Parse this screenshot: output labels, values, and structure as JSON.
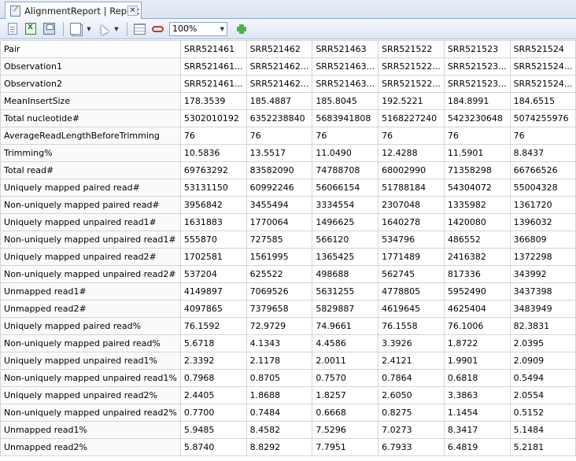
{
  "tab": {
    "title": "AlignmentReport | Report",
    "close_glyph": "✕",
    "icon": "report-icon"
  },
  "toolbar": {
    "buttons": [
      "new-document-icon",
      "export-excel-icon",
      "save-icon",
      "copy-pages-icon",
      "pointer-icon",
      "table-view-icon",
      "link-icon",
      "add-icon"
    ],
    "zoom": "100%"
  },
  "table": {
    "headers": [
      "Pair",
      "SRR521461",
      "SRR521462",
      "SRR521463",
      "SRR521522",
      "SRR521523",
      "SRR521524"
    ],
    "rows": [
      [
        "Observation1",
        "SRR521461...",
        "SRR521462...",
        "SRR521463...",
        "SRR521522...",
        "SRR521523...",
        "SRR521524..."
      ],
      [
        "Observation2",
        "SRR521461...",
        "SRR521462...",
        "SRR521463...",
        "SRR521522...",
        "SRR521523...",
        "SRR521524..."
      ],
      [
        "MeanInsertSize",
        "178.3539",
        "185.4887",
        "185.8045",
        "192.5221",
        "184.8991",
        "184.6515"
      ],
      [
        "Total nucleotide#",
        "5302010192",
        "6352238840",
        "5683941808",
        "5168227240",
        "5423230648",
        "5074255976"
      ],
      [
        "AverageReadLengthBeforeTrimming",
        "76",
        "76",
        "76",
        "76",
        "76",
        "76"
      ],
      [
        "Trimming%",
        "10.5836",
        "13.5517",
        "11.0490",
        "12.4288",
        "11.5901",
        "8.8437"
      ],
      [
        "Total read#",
        "69763292",
        "83582090",
        "74788708",
        "68002990",
        "71358298",
        "66766526"
      ],
      [
        "Uniquely mapped paired read#",
        "53131150",
        "60992246",
        "56066154",
        "51788184",
        "54304072",
        "55004328"
      ],
      [
        "Non-uniquely mapped paired read#",
        "3956842",
        "3455494",
        "3334554",
        "2307048",
        "1335982",
        "1361720"
      ],
      [
        "Uniquely mapped unpaired read1#",
        "1631883",
        "1770064",
        "1496625",
        "1640278",
        "1420080",
        "1396032"
      ],
      [
        "Non-uniquely mapped unpaired read1#",
        "555870",
        "727585",
        "566120",
        "534796",
        "486552",
        "366809"
      ],
      [
        "Uniquely mapped unpaired read2#",
        "1702581",
        "1561995",
        "1365425",
        "1771489",
        "2416382",
        "1372298"
      ],
      [
        "Non-uniquely mapped unpaired read2#",
        "537204",
        "625522",
        "498688",
        "562745",
        "817336",
        "343992"
      ],
      [
        "Unmapped read1#",
        "4149897",
        "7069526",
        "5631255",
        "4778805",
        "5952490",
        "3437398"
      ],
      [
        "Unmapped read2#",
        "4097865",
        "7379658",
        "5829887",
        "4619645",
        "4625404",
        "3483949"
      ],
      [
        "Uniquely mapped paired read%",
        "76.1592",
        "72.9729",
        "74.9661",
        "76.1558",
        "76.1006",
        "82.3831"
      ],
      [
        "Non-uniquely mapped paired read%",
        "5.6718",
        "4.1343",
        "4.4586",
        "3.3926",
        "1.8722",
        "2.0395"
      ],
      [
        "Uniquely mapped unpaired read1%",
        "2.3392",
        "2.1178",
        "2.0011",
        "2.4121",
        "1.9901",
        "2.0909"
      ],
      [
        "Non-uniquely mapped unpaired read1%",
        "0.7968",
        "0.8705",
        "0.7570",
        "0.7864",
        "0.6818",
        "0.5494"
      ],
      [
        "Uniquely mapped unpaired read2%",
        "2.4405",
        "1.8688",
        "1.8257",
        "2.6050",
        "3.3863",
        "2.0554"
      ],
      [
        "Non-uniquely mapped unpaired read2%",
        "0.7700",
        "0.7484",
        "0.6668",
        "0.8275",
        "1.1454",
        "0.5152"
      ],
      [
        "Unmapped read1%",
        "5.9485",
        "8.4582",
        "7.5296",
        "7.0273",
        "8.3417",
        "5.1484"
      ],
      [
        "Unmapped read2%",
        "5.8740",
        "8.8292",
        "7.7951",
        "6.7933",
        "6.4819",
        "5.2181"
      ]
    ]
  }
}
